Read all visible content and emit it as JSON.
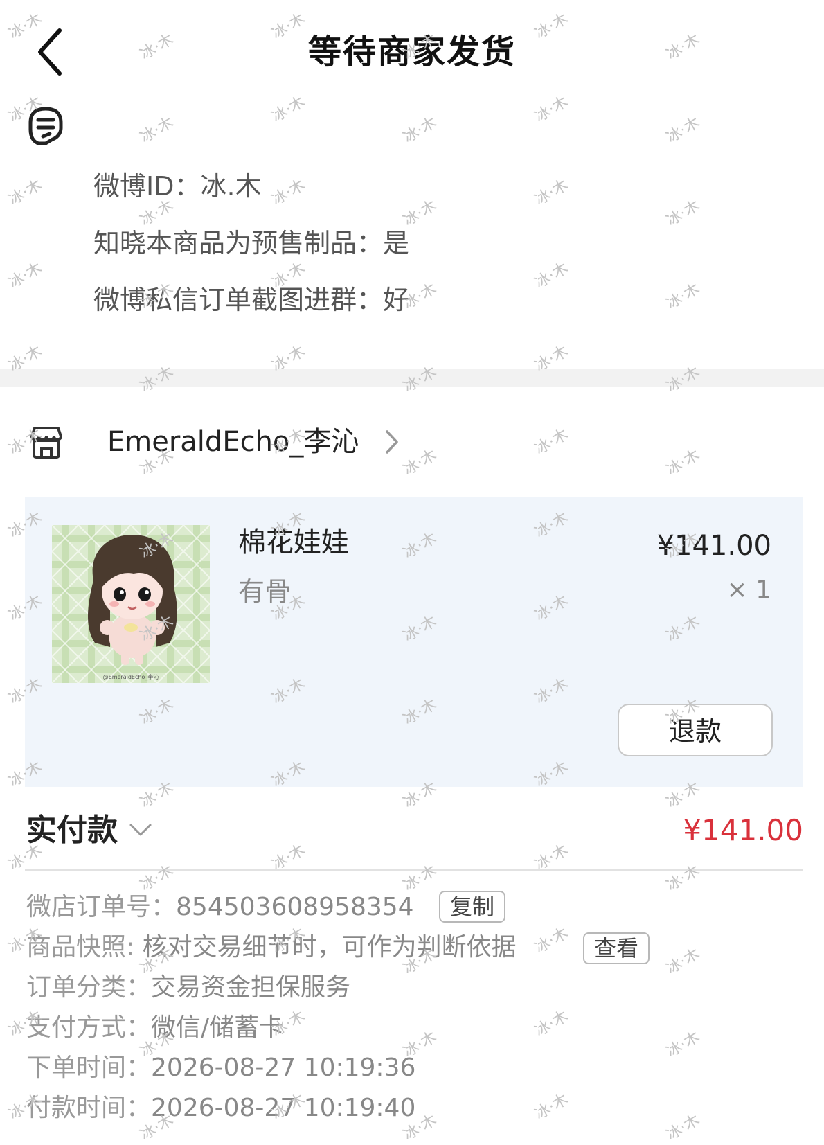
{
  "header": {
    "title": "等待商家发货"
  },
  "remarks": [
    {
      "label": "微博ID：",
      "value": "冰.木"
    },
    {
      "label": "知晓本商品为预售制品：",
      "value": "是"
    },
    {
      "label": "微博私信订单截图进群：",
      "value": "好"
    }
  ],
  "shop": {
    "name": "EmeraldEcho_李沁"
  },
  "product": {
    "name": "棉花娃娃",
    "spec": "有骨",
    "price": "¥141.00",
    "quantity": "× 1",
    "image_caption": "@EmeraldEcho_李沁",
    "refund_label": "退款"
  },
  "payment": {
    "label": "实付款",
    "amount": "¥141.00"
  },
  "details": {
    "order_no_label": "微店订单号：",
    "order_no": "854503608958354",
    "copy_label": "复制",
    "snapshot_label": "商品快照: ",
    "snapshot_text": "核对交易细节时，可作为判断依据",
    "view_label": "查看",
    "category_label": "订单分类：",
    "category": "交易资金担保服务",
    "pay_method_label": "支付方式：",
    "pay_method": "微信/储蓄卡",
    "order_time_label": "下单时间：",
    "order_time": "2026-08-27 10:19:36",
    "pay_time_label": "付款时间：",
    "pay_time": "2026-08-27 10:19:40"
  },
  "watermark": "冰·木",
  "colors": {
    "price_red": "#d9313b",
    "card_bg": "#f0f5fb"
  }
}
